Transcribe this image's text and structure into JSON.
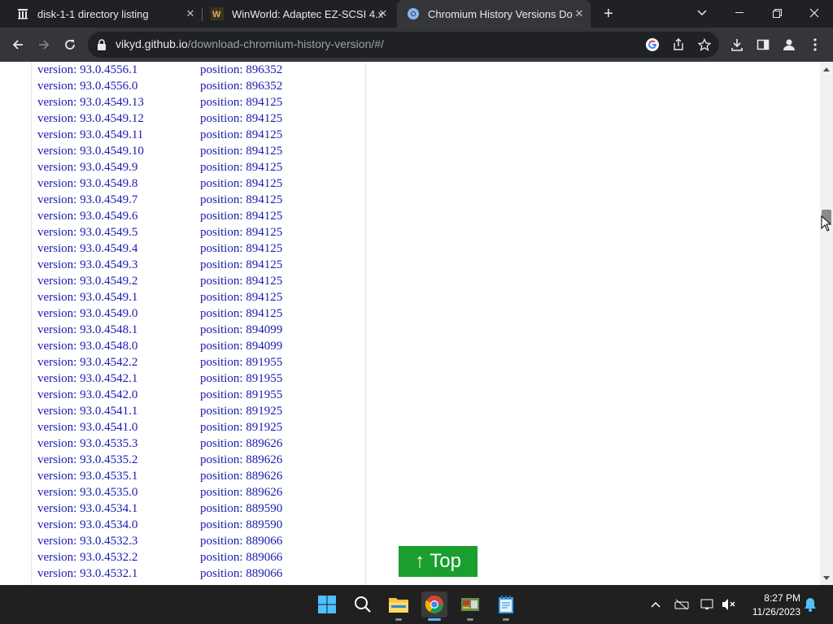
{
  "browser": {
    "tabs": [
      {
        "title": "disk-1-1 directory listing",
        "favicon": "archive-icon"
      },
      {
        "title": "WinWorld: Adaptec EZ-SCSI 4.x",
        "favicon": "winworld-icon"
      },
      {
        "title": "Chromium History Versions Dow",
        "favicon": "chromium-icon",
        "active": true
      }
    ],
    "new_tab": "+",
    "address": {
      "host": "vikyd.github.io",
      "path": "/download-chromium-history-version/#/"
    }
  },
  "page": {
    "version_label": "version:",
    "position_label": "position:",
    "rows": [
      {
        "version": "93.0.4556.1",
        "position": "896352"
      },
      {
        "version": "93.0.4556.0",
        "position": "896352"
      },
      {
        "version": "93.0.4549.13",
        "position": "894125"
      },
      {
        "version": "93.0.4549.12",
        "position": "894125"
      },
      {
        "version": "93.0.4549.11",
        "position": "894125"
      },
      {
        "version": "93.0.4549.10",
        "position": "894125"
      },
      {
        "version": "93.0.4549.9",
        "position": "894125"
      },
      {
        "version": "93.0.4549.8",
        "position": "894125"
      },
      {
        "version": "93.0.4549.7",
        "position": "894125"
      },
      {
        "version": "93.0.4549.6",
        "position": "894125"
      },
      {
        "version": "93.0.4549.5",
        "position": "894125"
      },
      {
        "version": "93.0.4549.4",
        "position": "894125"
      },
      {
        "version": "93.0.4549.3",
        "position": "894125"
      },
      {
        "version": "93.0.4549.2",
        "position": "894125"
      },
      {
        "version": "93.0.4549.1",
        "position": "894125"
      },
      {
        "version": "93.0.4549.0",
        "position": "894125"
      },
      {
        "version": "93.0.4548.1",
        "position": "894099"
      },
      {
        "version": "93.0.4548.0",
        "position": "894099"
      },
      {
        "version": "93.0.4542.2",
        "position": "891955"
      },
      {
        "version": "93.0.4542.1",
        "position": "891955"
      },
      {
        "version": "93.0.4542.0",
        "position": "891955"
      },
      {
        "version": "93.0.4541.1",
        "position": "891925"
      },
      {
        "version": "93.0.4541.0",
        "position": "891925"
      },
      {
        "version": "93.0.4535.3",
        "position": "889626"
      },
      {
        "version": "93.0.4535.2",
        "position": "889626"
      },
      {
        "version": "93.0.4535.1",
        "position": "889626"
      },
      {
        "version": "93.0.4535.0",
        "position": "889626"
      },
      {
        "version": "93.0.4534.1",
        "position": "889590"
      },
      {
        "version": "93.0.4534.0",
        "position": "889590"
      },
      {
        "version": "93.0.4532.3",
        "position": "889066"
      },
      {
        "version": "93.0.4532.2",
        "position": "889066"
      },
      {
        "version": "93.0.4532.1",
        "position": "889066"
      }
    ],
    "top_button": "↑ Top"
  },
  "taskbar": {
    "apps": [
      "windows-start-icon",
      "search-icon",
      "file-explorer-icon",
      "chrome-icon",
      "app-icon",
      "notepad-icon"
    ],
    "time": "8:27 PM",
    "date": "11/26/2023"
  },
  "colors": {
    "link": "#1a1ab0",
    "top_button": "#1a9e2e",
    "tab_active": "#35363a",
    "tabstrip": "#202124"
  }
}
